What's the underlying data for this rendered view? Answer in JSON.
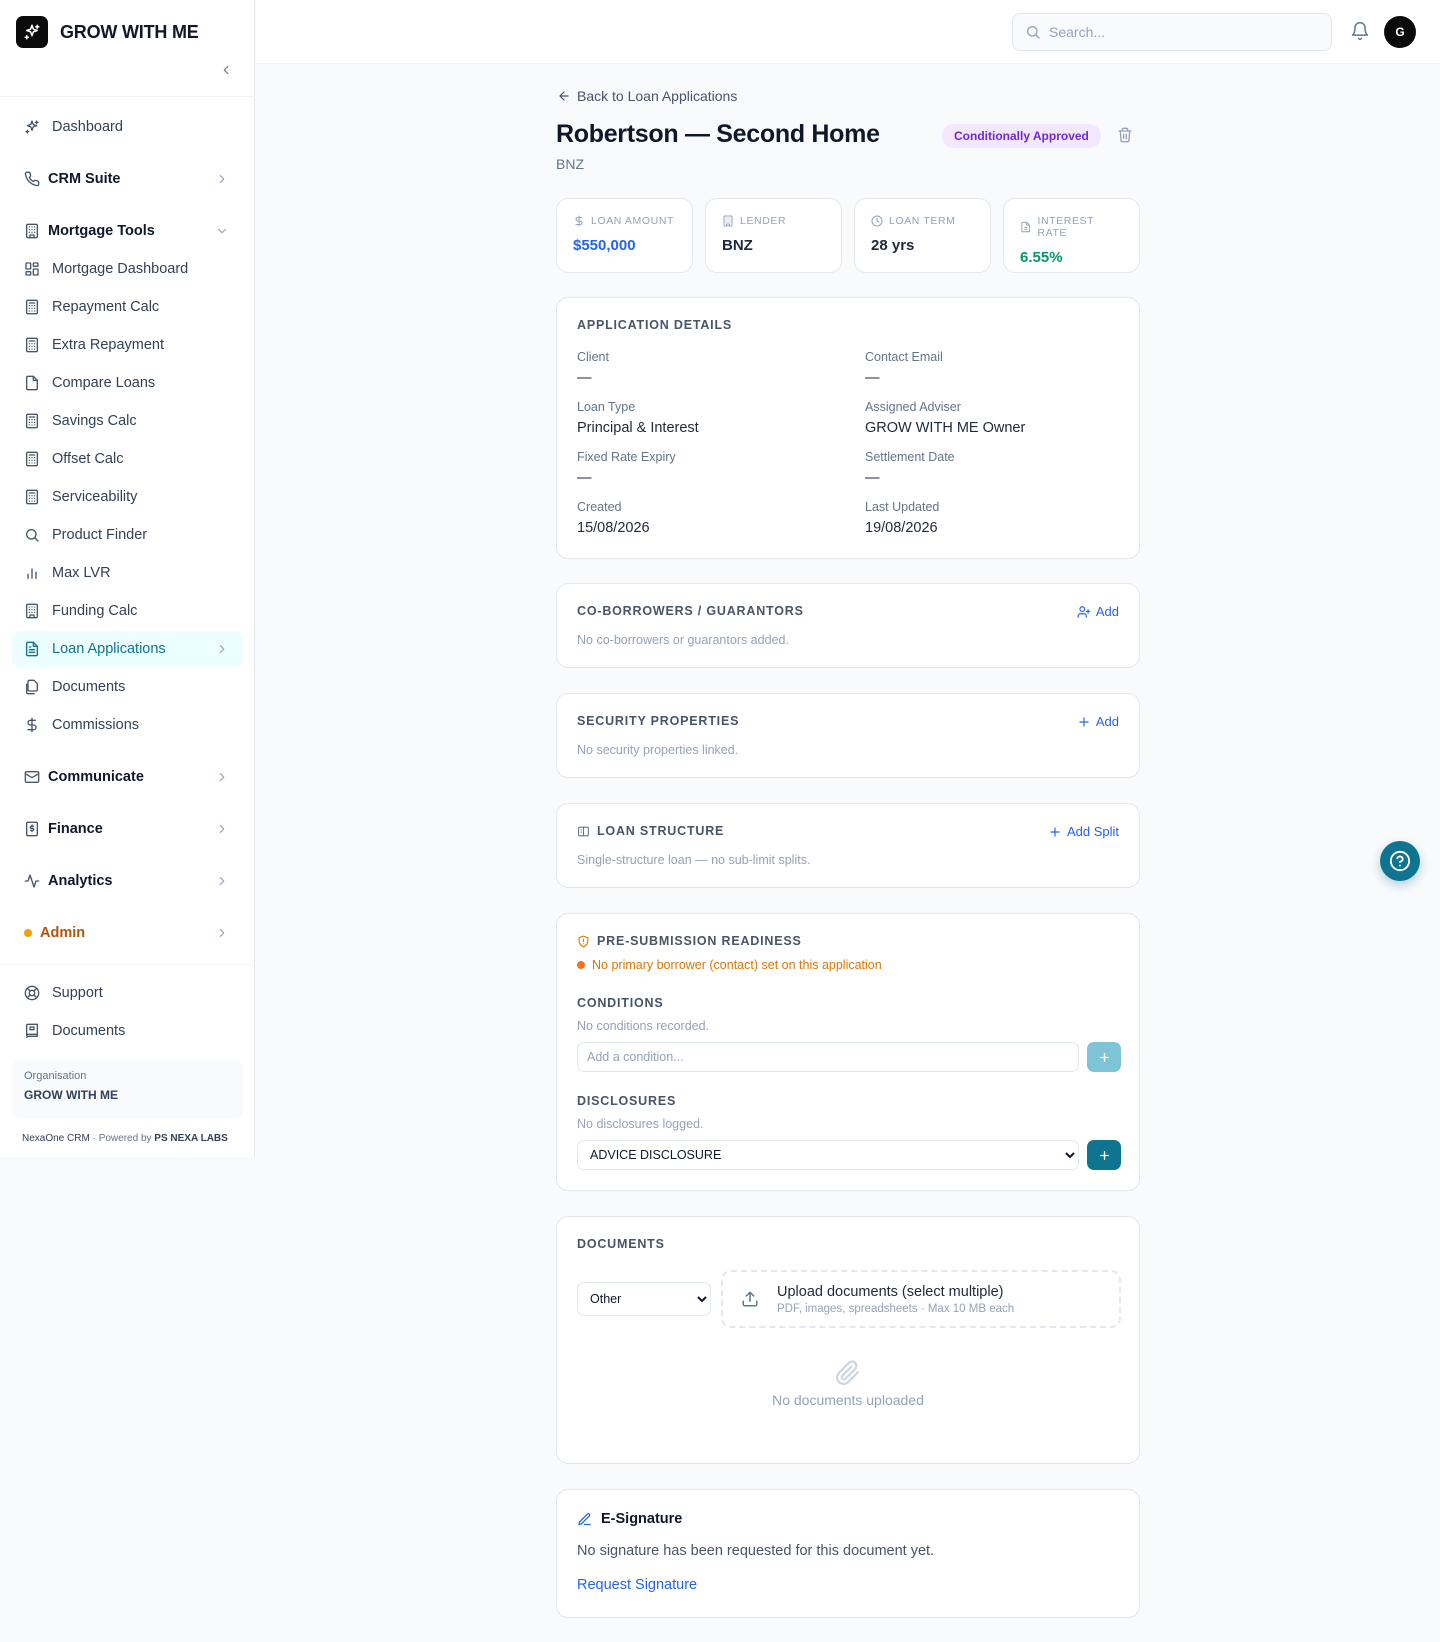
{
  "brand": {
    "name": "GROW WITH ME",
    "icon": "sparkle-icon"
  },
  "sidebar": {
    "items": [
      {
        "label": "Dashboard",
        "icon": "sparkle-icon"
      },
      {
        "label": "CRM Suite",
        "icon": "phone-icon",
        "group": true
      },
      {
        "label": "Mortgage Tools",
        "icon": "building-icon",
        "group": true,
        "expanded": true
      },
      {
        "label": "Mortgage Dashboard",
        "icon": "grid-icon"
      },
      {
        "label": "Repayment Calc",
        "icon": "calculator-icon"
      },
      {
        "label": "Extra Repayment",
        "icon": "calculator-icon"
      },
      {
        "label": "Compare Loans",
        "icon": "file-icon"
      },
      {
        "label": "Savings Calc",
        "icon": "calculator-icon"
      },
      {
        "label": "Offset Calc",
        "icon": "calculator-icon"
      },
      {
        "label": "Serviceability",
        "icon": "calculator-icon"
      },
      {
        "label": "Product Finder",
        "icon": "search-icon"
      },
      {
        "label": "Max LVR",
        "icon": "bar-chart-icon"
      },
      {
        "label": "Funding Calc",
        "icon": "building-icon"
      },
      {
        "label": "Loan Applications",
        "icon": "file-text-icon",
        "active": true
      },
      {
        "label": "Documents",
        "icon": "files-icon"
      },
      {
        "label": "Commissions",
        "icon": "dollar-icon"
      },
      {
        "label": "Communicate",
        "icon": "mail-icon",
        "group": true
      },
      {
        "label": "Finance",
        "icon": "receipt-icon",
        "group": true
      },
      {
        "label": "Analytics",
        "icon": "activity-icon",
        "group": true
      },
      {
        "label": "Admin",
        "icon": "dot-icon",
        "group": true,
        "accent": "#b45309"
      },
      {
        "label": "Support",
        "icon": "lifebuoy-icon"
      },
      {
        "label": "Documents",
        "icon": "book-icon"
      }
    ],
    "org_label": "Organisation",
    "org_name": "GROW WITH ME",
    "credits_app": "NexaOne CRM",
    "credits_sep": " · Powered by ",
    "credits_company": "PS NEXA LABS"
  },
  "topbar": {
    "search_placeholder": "Search...",
    "avatar_initial": "G"
  },
  "page": {
    "back_label": "Back to Loan Applications",
    "title": "Robertson — Second Home",
    "subtitle": "BNZ",
    "status": "Conditionally Approved",
    "status_colors": {
      "bg": "#f3e8ff",
      "fg": "#6d28d9"
    }
  },
  "stats": [
    {
      "label": "LOAN AMOUNT",
      "value": "$550,000",
      "icon": "dollar-icon",
      "color": "#2563eb"
    },
    {
      "label": "LENDER",
      "value": "BNZ",
      "icon": "building-icon",
      "color": "#1e293b"
    },
    {
      "label": "LOAN TERM",
      "value": "28 yrs",
      "icon": "clock-icon",
      "color": "#1e293b"
    },
    {
      "label": "INTEREST RATE",
      "value": "6.55%",
      "icon": "file-icon",
      "color": "#059669"
    }
  ],
  "details": {
    "heading": "APPLICATION DETAILS",
    "fields": [
      {
        "label": "Client",
        "value": "—"
      },
      {
        "label": "Contact Email",
        "value": "—"
      },
      {
        "label": "Loan Type",
        "value": "Principal & Interest"
      },
      {
        "label": "Assigned Adviser",
        "value": "GROW WITH ME Owner"
      },
      {
        "label": "Fixed Rate Expiry",
        "value": "—"
      },
      {
        "label": "Settlement Date",
        "value": "—"
      },
      {
        "label": "Created",
        "value": "15/08/2026"
      },
      {
        "label": "Last Updated",
        "value": "19/08/2026"
      }
    ]
  },
  "coborrowers": {
    "heading": "CO-BORROWERS / GUARANTORS",
    "action": "Add",
    "empty": "No co-borrowers or guarantors added."
  },
  "security": {
    "heading": "SECURITY PROPERTIES",
    "action": "Add",
    "empty": "No security properties linked."
  },
  "structure": {
    "heading": "LOAN STRUCTURE",
    "action": "Add Split",
    "empty": "Single-structure loan — no sub-limit splits."
  },
  "readiness": {
    "heading": "PRE-SUBMISSION READINESS",
    "warning": "No primary borrower (contact) set on this application",
    "conditions_heading": "CONDITIONS",
    "conditions_empty": "No conditions recorded.",
    "condition_placeholder": "Add a condition...",
    "disclosures_heading": "DISCLOSURES",
    "disclosures_empty": "No disclosures logged.",
    "disclosure_selected": "ADVICE DISCLOSURE"
  },
  "documents": {
    "heading": "DOCUMENTS",
    "category_selected": "Other",
    "upload_title": "Upload documents (select multiple)",
    "upload_hint": "PDF, images, spreadsheets · Max 10 MB each",
    "empty": "No documents uploaded"
  },
  "esignature": {
    "heading": "E-Signature",
    "text": "No signature has been requested for this document yet.",
    "action": "Request Signature"
  }
}
